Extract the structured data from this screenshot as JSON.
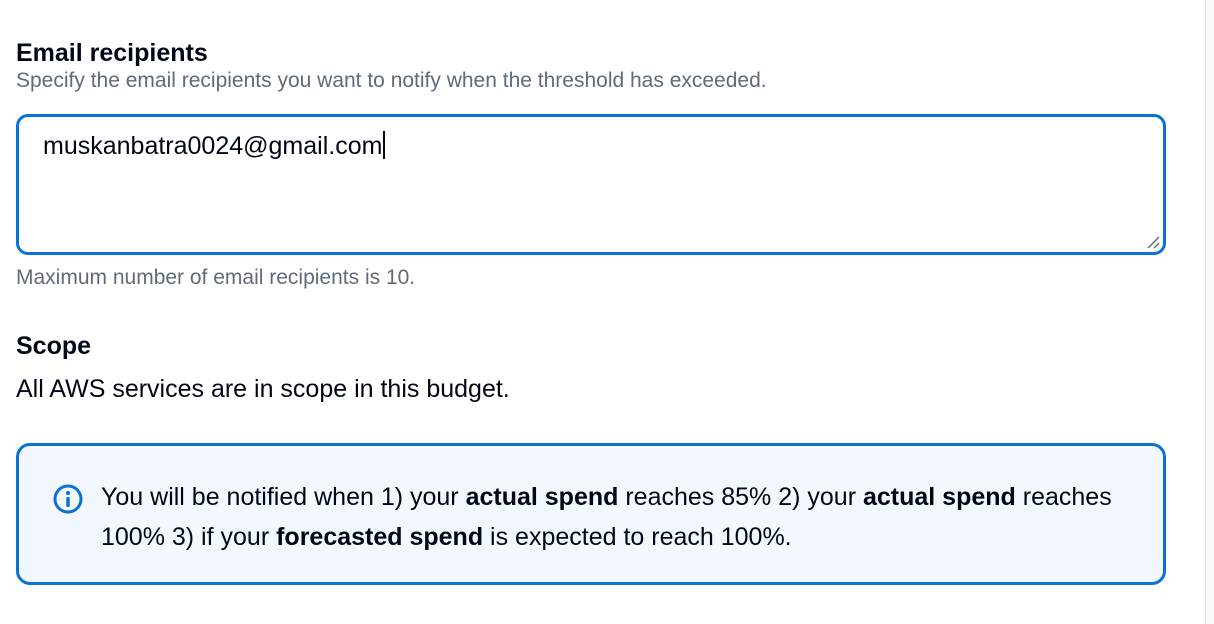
{
  "email": {
    "label": "Email recipients",
    "description": "Specify the email recipients you want to notify when the threshold has exceeded.",
    "value": "muskanbatra0024@gmail.com",
    "hint": "Maximum number of email recipients is 10."
  },
  "scope": {
    "label": "Scope",
    "text": "All AWS services are in scope in this budget."
  },
  "alert": {
    "icon": "info-icon",
    "part1": "You will be notified when 1) your ",
    "bold1": "actual spend",
    "part2": " reaches 85% 2) your ",
    "bold2": "actual spend",
    "part3": " reaches 100% 3) if your ",
    "bold3": "forecasted spend",
    "part4": " is expected to reach 100%."
  },
  "colors": {
    "accent": "#0972d3",
    "alert_background": "#f2f8fd",
    "secondary_text": "#5f6b7a"
  }
}
